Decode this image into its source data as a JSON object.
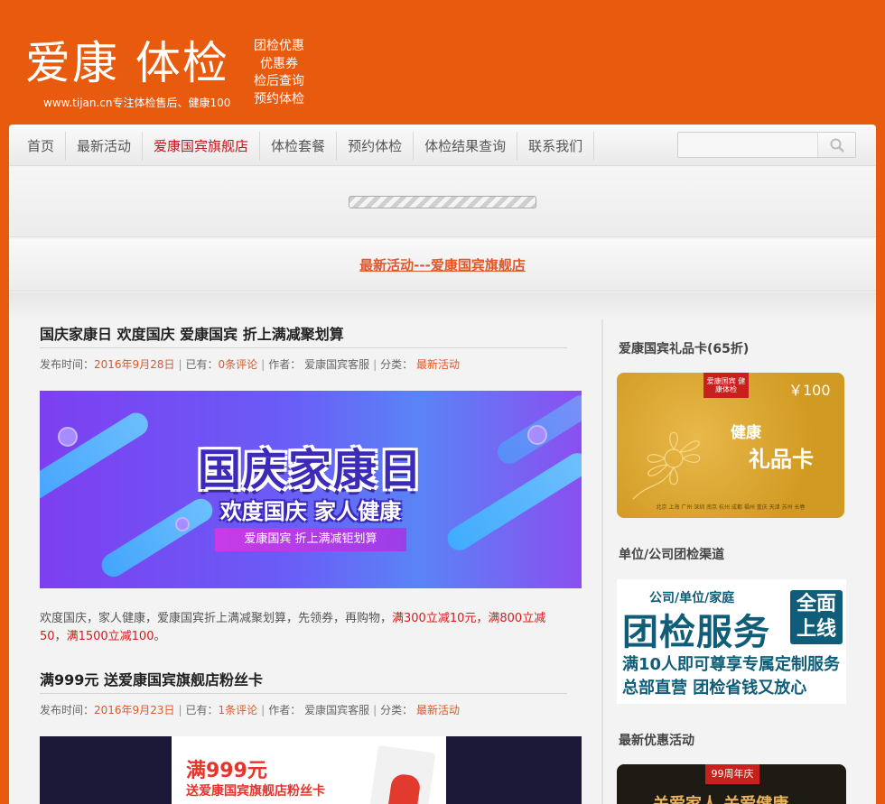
{
  "header": {
    "logo_title": "爱康 体检",
    "logo_sub": "www.tijan.cn专注体检售后、健康100",
    "links": [
      "团检优惠",
      "优惠券",
      "检后查询",
      "预约体检"
    ]
  },
  "nav": {
    "items": [
      "首页",
      "最新活动",
      "爱康国宾旗舰店",
      "体检套餐",
      "预约体检",
      "体检结果查询",
      "联系我们"
    ],
    "active_index": 2
  },
  "search": {
    "value": "",
    "placeholder": ""
  },
  "section_title": "最新活动---爱康国宾旗舰店",
  "posts": [
    {
      "title": "国庆家康日 欢度国庆 爱康国宾 折上满减聚划算",
      "meta": {
        "time_label": "发布时间：",
        "time": "2016年9月28日",
        "has_label": "已有：",
        "comments": "0条评论",
        "author_label": "作者：",
        "author": "爱康国宾客服",
        "category_label": "分类：",
        "category": "最新活动"
      },
      "banner": {
        "title": "国庆家康日",
        "subtitle": "欢度国庆 家人健康",
        "ribbon": "爱康国宾 折上满减钜划算"
      },
      "excerpt": {
        "text": "欢度国庆，家人健康，爱康国宾折上满减聚划算，先领券，再购物，",
        "promo1": "满300立减10元",
        "comma1": "，",
        "promo2": "满800立减50",
        "comma2": "，",
        "promo3": "满1500立减100",
        "end": "。"
      }
    },
    {
      "title": "满999元 送爱康国宾旗舰店粉丝卡",
      "meta": {
        "time_label": "发布时间：",
        "time": "2016年9月23日",
        "has_label": "已有：",
        "comments": "1条评论",
        "author_label": "作者：",
        "author": "爱康国宾客服",
        "category_label": "分类：",
        "category": "最新活动"
      },
      "banner": {
        "line1": "满999元",
        "line2": "送爱康国宾旗舰店粉丝卡"
      }
    }
  ],
  "sidebar": {
    "gift_title": "爱康国宾礼品卡(65折)",
    "gift_card": {
      "tag": "爱康国宾 健康体检",
      "amount": "￥100",
      "name1": "健康",
      "name2": "礼品卡",
      "cities": "北京 上海 广州 深圳 南京 杭州 成都 福州 重庆 天津 苏州 长春"
    },
    "group_title": "单位/公司团检渠道",
    "group_card": {
      "line1": "公司/单位/家庭",
      "big": "团检服务",
      "badge1": "全面",
      "badge2": "上线",
      "line3": "满10人即可尊享专属定制服务",
      "line4": "总部直营 团检省钱又放心"
    },
    "promo_title": "最新优惠活动",
    "promo_card": {
      "tag": "99周年庆",
      "text": "关爱家人 关爱健康"
    }
  },
  "colors": {
    "brand_orange": "#e85a0e",
    "nav_active": "#c0191c",
    "link_orange": "#e0582a",
    "promo_red": "#d41c1c"
  }
}
